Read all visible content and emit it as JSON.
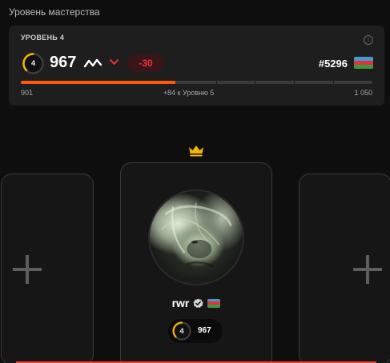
{
  "section": {
    "title": "Уровень мастерства"
  },
  "level_card": {
    "level_label": "УРОВЕНЬ 4",
    "level_number": "4",
    "elo": "967",
    "trend_icon": "trend-wave-icon",
    "direction_icon": "chevron-down-icon",
    "elo_change": "-30",
    "rank": "#5296",
    "country_flag": "flag-azerbaijan-icon",
    "progress": {
      "min_label": "901",
      "max_label": "1 050",
      "to_next_label": "+84 к Уровню 5",
      "fraction": 0.44
    },
    "info_icon": "info-icon"
  },
  "lobby": {
    "leader_icon": "crown-icon",
    "empty_slot_icon": "plus-icon",
    "player": {
      "name": "rwr",
      "verified_icon": "verified-badge-icon",
      "country_flag": "flag-azerbaijan-icon",
      "level": "4",
      "elo": "967"
    }
  },
  "colors": {
    "accent_orange": "#ff5a0a",
    "negative_red": "#f0313b",
    "crown_gold": "#f5b400",
    "background": "#0e0e0e",
    "card": "#1e1e1e"
  }
}
